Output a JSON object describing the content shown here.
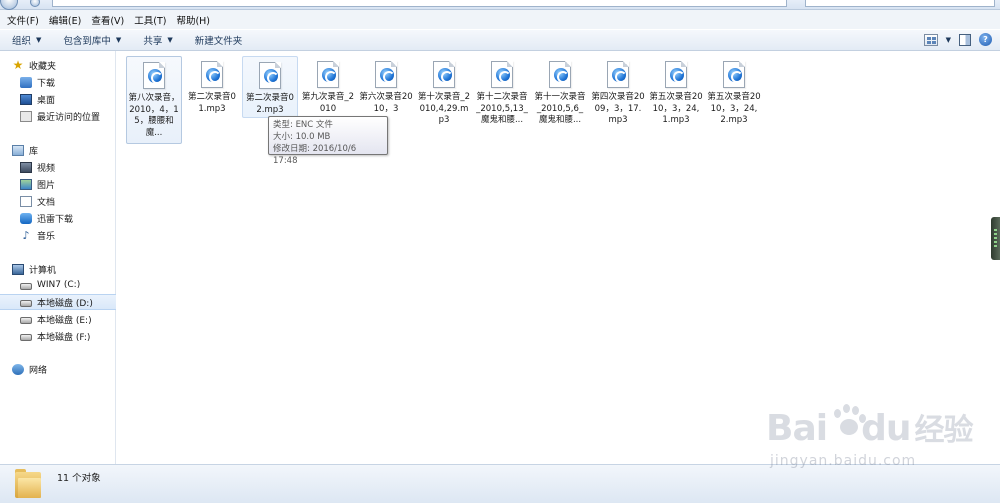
{
  "menu": [
    "文件(F)",
    "编辑(E)",
    "查看(V)",
    "工具(T)",
    "帮助(H)"
  ],
  "toolbar": {
    "organize": "组织",
    "include_library": "包含到库中",
    "share": "共享",
    "new_folder": "新建文件夹"
  },
  "nav": {
    "favorites": "收藏夹",
    "downloads": "下载",
    "desktop": "桌面",
    "recent": "最近访问的位置",
    "libraries": "库",
    "videos": "视频",
    "pictures": "图片",
    "documents": "文档",
    "thunder": "迅雷下载",
    "music": "音乐",
    "computer": "计算机",
    "drive_c": "WIN7 (C:)",
    "drive_d": "本地磁盘 (D:)",
    "drive_e": "本地磁盘 (E:)",
    "drive_f": "本地磁盘 (F:)",
    "network": "网络"
  },
  "files": [
    {
      "name": "第八次录音，2010，4，15，腰腰和魔..."
    },
    {
      "name": "第二次录音01.mp3"
    },
    {
      "name": "第二次录音02.mp3"
    },
    {
      "name": "第九次录音_2010"
    },
    {
      "name": "第六次录音2010，3"
    },
    {
      "name": "第十次录音_2010,4,29.mp3"
    },
    {
      "name": "第十二次录音_2010,5,13_魔鬼和腰..."
    },
    {
      "name": "第十一次录音_2010,5,6_魔鬼和腰..."
    },
    {
      "name": "第四次录音2009，3，17.mp3"
    },
    {
      "name": "第五次录音2010，3，24,1.mp3"
    },
    {
      "name": "第五次录音2010，3，24,2.mp3"
    }
  ],
  "tooltip": {
    "type": "类型: ENC 文件",
    "size": "大小: 10.0 MB",
    "modified": "修改日期: 2016/10/6 17:48"
  },
  "status": {
    "count": "11 个对象"
  },
  "watermark": {
    "logo": "Bai",
    "logo2": "du",
    "brand": "经验",
    "url": "jingyan.baidu.com"
  },
  "icons": {
    "file": "enc-audio-file-icon",
    "folder": "folder-icon"
  }
}
